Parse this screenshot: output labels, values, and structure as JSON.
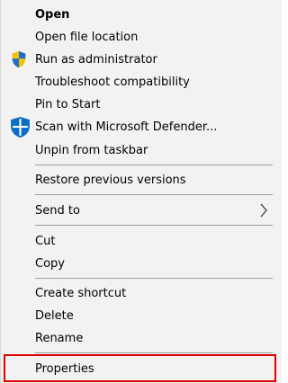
{
  "menu": {
    "items": [
      {
        "label": "Open",
        "icon": null,
        "bold": true
      },
      {
        "label": "Open file location",
        "icon": null
      },
      {
        "label": "Run as administrator",
        "icon": "uac-shield-icon"
      },
      {
        "label": "Troubleshoot compatibility",
        "icon": null
      },
      {
        "label": "Pin to Start",
        "icon": null
      },
      {
        "label": "Scan with Microsoft Defender...",
        "icon": "defender-icon"
      },
      {
        "label": "Unpin from taskbar",
        "icon": null
      },
      {
        "label": "Restore previous versions",
        "icon": null
      },
      {
        "label": "Send to",
        "icon": null,
        "submenu": true
      },
      {
        "label": "Cut",
        "icon": null
      },
      {
        "label": "Copy",
        "icon": null
      },
      {
        "label": "Create shortcut",
        "icon": null
      },
      {
        "label": "Delete",
        "icon": null
      },
      {
        "label": "Rename",
        "icon": null
      },
      {
        "label": "Properties",
        "icon": null,
        "highlighted": true
      }
    ]
  },
  "colors": {
    "menu_background": "#f2f2f2",
    "separator": "#a0a0a0",
    "highlight_border": "#e00000",
    "shield_blue": "#1f6fd1",
    "shield_yellow": "#f2c200",
    "defender_blue": "#0b6fc8"
  }
}
